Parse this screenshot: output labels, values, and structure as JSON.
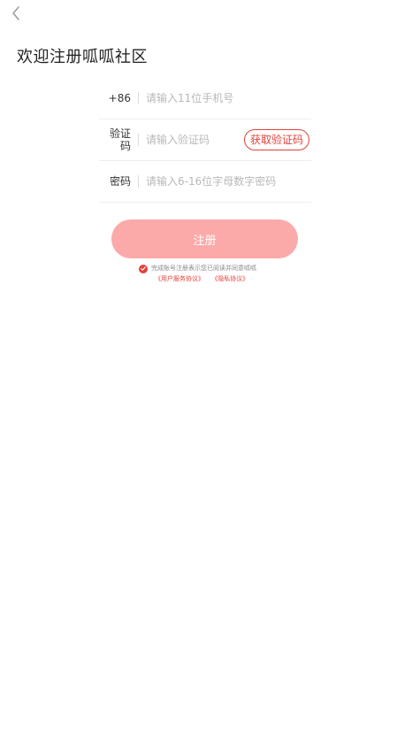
{
  "header": {
    "title": "欢迎注册呱呱社区"
  },
  "form": {
    "phone": {
      "prefix": "+86",
      "placeholder": "请输入11位手机号"
    },
    "code": {
      "label": "验证\n码",
      "placeholder": "请输入验证码",
      "get_code_label": "获取验证码"
    },
    "password": {
      "label": "密码",
      "placeholder": "请输入6-16位字母数字密码"
    }
  },
  "register_button_label": "注册",
  "agreement": {
    "text": "完成账号注册表示您已阅读并同意呱呱",
    "user_agreement": "《用户服务协议》",
    "privacy_agreement": "《隐私协议》"
  },
  "colors": {
    "accent": "#e3413b",
    "button_bg": "#fcaaa9"
  },
  "icons": {
    "back": "back-arrow-icon",
    "check": "check-icon"
  }
}
